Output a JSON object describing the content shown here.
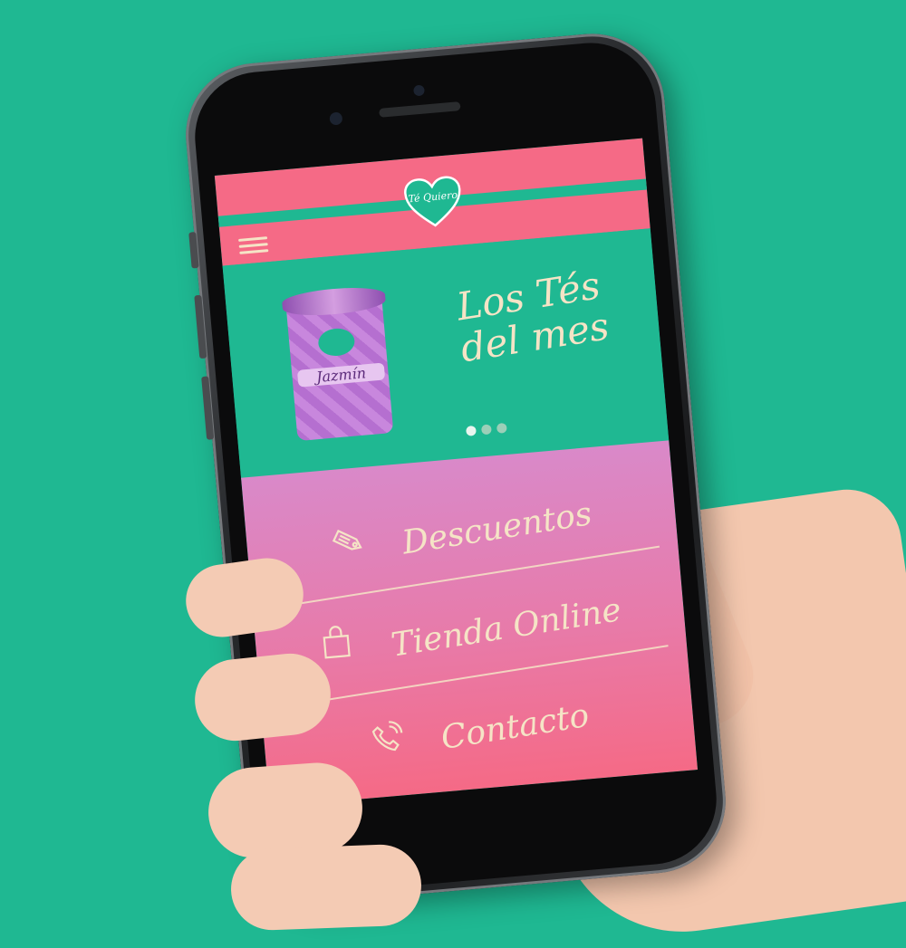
{
  "brand": {
    "logo_text": "Té Quiero"
  },
  "hero": {
    "headline_line1": "Los Tés",
    "headline_line2": "del mes",
    "product_label": "Jazmín",
    "slides_count": 3,
    "active_slide": 1
  },
  "menu": {
    "items": [
      {
        "label": "Descuentos",
        "icon": "tag-icon"
      },
      {
        "label": "Tienda Online",
        "icon": "shopping-bag-icon"
      },
      {
        "label": "Contacto",
        "icon": "phone-icon"
      }
    ]
  },
  "colors": {
    "background": "#1fb892",
    "header_pink": "#f56a86",
    "menu_gradient_top": "#d989c9",
    "menu_gradient_bottom": "#f56a86",
    "text_cream": "#f5e4c6"
  }
}
